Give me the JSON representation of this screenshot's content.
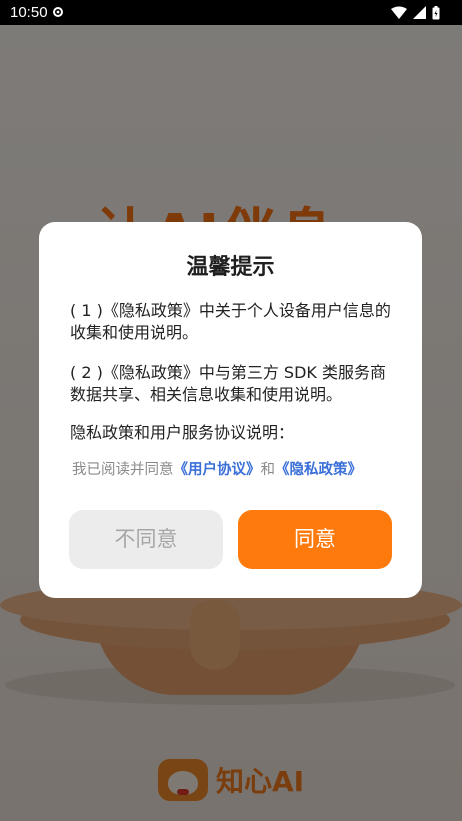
{
  "status_bar": {
    "time": "10:50",
    "icons": [
      "settings-gear-icon",
      "wifi-icon",
      "signal-icon",
      "battery-icon"
    ]
  },
  "splash": {
    "slogan": "让AI伴身",
    "brand_name": "知心AI",
    "brand_color": "#ff7412"
  },
  "dialog": {
    "title": "温馨提示",
    "para1": "( 1 )《隐私政策》中关于个人设备用户信息的收集和使用说明。",
    "para2": "( 2 )《隐私政策》中与第三方 SDK 类服务商数据共享、相关信息收集和使用说明。",
    "para3": "隐私政策和用户服务协议说明：",
    "agree_prefix": "我已阅读并同意",
    "user_agreement_link": "《用户协议》",
    "and_text": "和",
    "privacy_policy_link": "《隐私政策》",
    "disagree_label": "不同意",
    "agree_label": "同意"
  },
  "colors": {
    "accent": "#ff7a0c",
    "link": "#3a6fd8",
    "disabled_button_bg": "#ececec"
  }
}
